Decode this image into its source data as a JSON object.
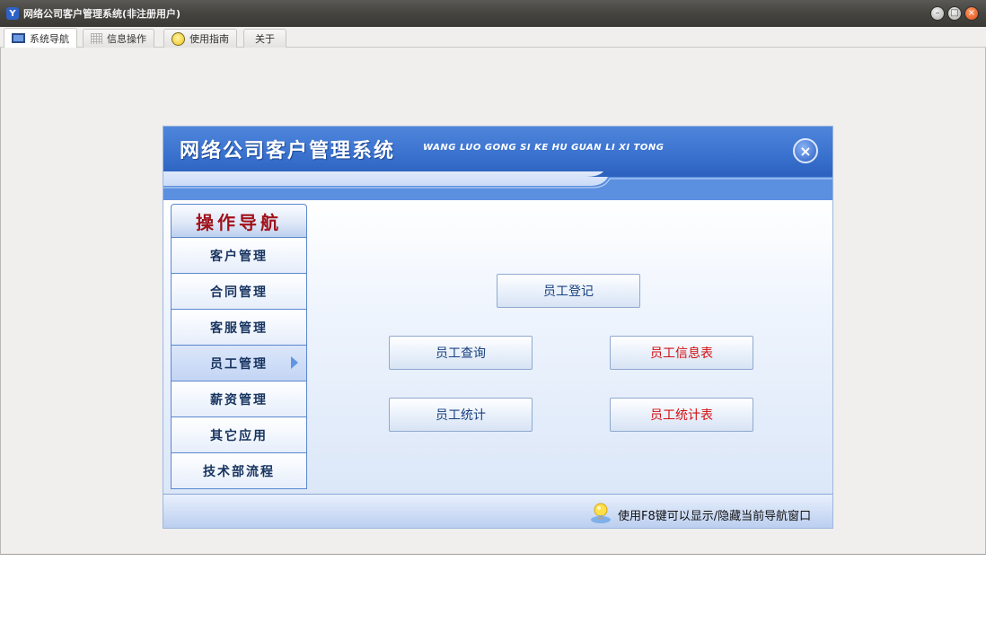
{
  "window": {
    "title": "网络公司客户管理系统(非注册用户)",
    "icon_letter": "Y",
    "buttons": {
      "minimize": "–",
      "maximize": "□",
      "close": "×"
    }
  },
  "tabs": [
    {
      "label": "系统导航",
      "icon": "monitor-icon",
      "active": true
    },
    {
      "label": "信息操作",
      "icon": "grid-icon",
      "active": false
    },
    {
      "label": "使用指南",
      "icon": "smile-icon",
      "active": false
    },
    {
      "label": "关于",
      "icon": "",
      "active": false
    }
  ],
  "panel": {
    "title": "网络公司客户管理系统",
    "subtitle": "WANG LUO GONG SI KE HU GUAN LI XI TONG",
    "close_symbol": "×",
    "menu": {
      "header": "操作导航",
      "items": [
        {
          "label": "客户管理",
          "active": false
        },
        {
          "label": "合同管理",
          "active": false
        },
        {
          "label": "客服管理",
          "active": false
        },
        {
          "label": "员工管理",
          "active": true
        },
        {
          "label": "薪资管理",
          "active": false
        },
        {
          "label": "其它应用",
          "active": false
        },
        {
          "label": "技术部流程",
          "active": false
        }
      ]
    },
    "actions": {
      "register": "员工登记",
      "query": "员工查询",
      "info_table": "员工信息表",
      "stats": "员工统计",
      "stats_table": "员工统计表"
    },
    "footer_tip": "使用F8键可以显示/隐藏当前导航窗口"
  },
  "colors": {
    "header_blue": "#3a72cf",
    "menu_header_text": "#a1121a",
    "action_red": "#d40e10",
    "action_blue": "#17407e"
  }
}
